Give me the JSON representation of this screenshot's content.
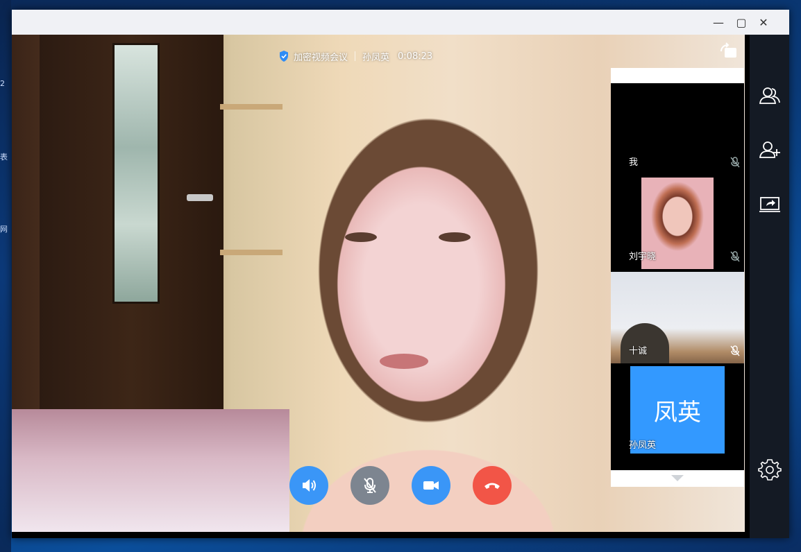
{
  "desktop": {
    "edge_labels": [
      "2",
      "表",
      "网"
    ]
  },
  "window": {
    "controls": {
      "minimize_glyph": "—",
      "maximize_glyph": "▢",
      "close_glyph": "✕"
    }
  },
  "call": {
    "mode_label": "加密视频会议",
    "host_name": "孙凤英",
    "duration": "0:08:23"
  },
  "participants": [
    {
      "name": "我",
      "muted": true
    },
    {
      "name": "刘宇晓",
      "muted": true
    },
    {
      "name": "十诚",
      "muted": true
    },
    {
      "name": "孙凤英",
      "avatar_text": "凤英",
      "muted": false
    }
  ],
  "controls": {
    "speaker": {
      "color": "#3a96f7",
      "icon": "speaker-icon"
    },
    "microphone": {
      "color": "#7d8590",
      "icon": "mic-off-icon"
    },
    "camera": {
      "color": "#3a96f7",
      "icon": "camera-icon"
    },
    "hangup": {
      "color": "#f25547",
      "icon": "hangup-icon"
    }
  },
  "sidebar": {
    "items": [
      {
        "icon": "members-icon"
      },
      {
        "icon": "add-member-icon"
      },
      {
        "icon": "share-screen-icon"
      },
      {
        "icon": "settings-icon"
      }
    ]
  },
  "colors": {
    "avatar_bg": "#3399ff",
    "titlebar_bg": "#f0f1f5",
    "sidebar_bg": "#141a24"
  }
}
